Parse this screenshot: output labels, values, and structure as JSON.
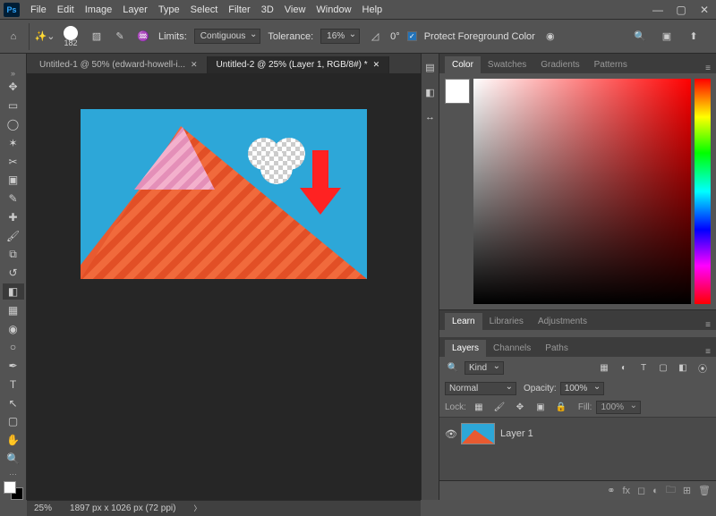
{
  "app": {
    "logo_text": "Ps"
  },
  "menu": [
    "File",
    "Edit",
    "Image",
    "Layer",
    "Type",
    "Select",
    "Filter",
    "3D",
    "View",
    "Window",
    "Help"
  ],
  "window_controls": {
    "min": "—",
    "max": "▢",
    "close": "✕"
  },
  "options": {
    "brush_size": "182",
    "limits_label": "Limits:",
    "limits_value": "Contiguous",
    "tolerance_label": "Tolerance:",
    "tolerance_value": "16%",
    "angle_value": "0°",
    "protect_fg_label": "Protect Foreground Color"
  },
  "tabs": [
    {
      "label": "Untitled-1 @ 50% (edward-howell-i...",
      "active": false
    },
    {
      "label": "Untitled-2 @ 25% (Layer 1, RGB/8#) *",
      "active": true
    }
  ],
  "color_tabs": [
    "Color",
    "Swatches",
    "Gradients",
    "Patterns"
  ],
  "mid_tabs": [
    "Learn",
    "Libraries",
    "Adjustments"
  ],
  "layer_tabs": [
    "Layers",
    "Channels",
    "Paths"
  ],
  "layers": {
    "kind_label": "Kind",
    "blend_mode": "Normal",
    "opacity_label": "Opacity:",
    "opacity_value": "100%",
    "lock_label": "Lock:",
    "fill_label": "Fill:",
    "fill_value": "100%",
    "items": [
      {
        "name": "Layer 1",
        "visible": true
      }
    ]
  },
  "status": {
    "zoom": "25%",
    "info": "1897 px x 1026 px (72 ppi)"
  },
  "icons": {
    "search": "🔍"
  }
}
